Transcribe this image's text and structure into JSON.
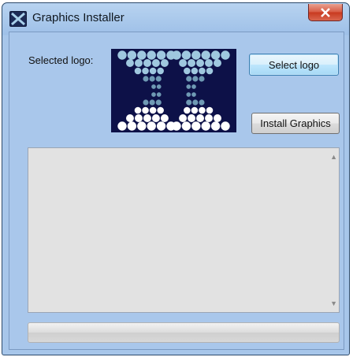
{
  "window": {
    "title": "Graphics Installer",
    "close_label": "x"
  },
  "main": {
    "selected_logo_label": "Selected logo:",
    "select_logo_button": "Select logo",
    "install_graphics_button": "Install Graphics",
    "log_text": "",
    "progress": 0
  },
  "icons": {
    "app": "app-logo-icon",
    "close": "close-icon",
    "scroll_up": "scroll-up-arrow-icon",
    "scroll_down": "scroll-down-arrow-icon"
  },
  "colors": {
    "logo_background": "#0d1148",
    "dot_light": "#ffffff",
    "dot_mid": "#9fc8df",
    "dot_dark": "#6f9ab4"
  }
}
